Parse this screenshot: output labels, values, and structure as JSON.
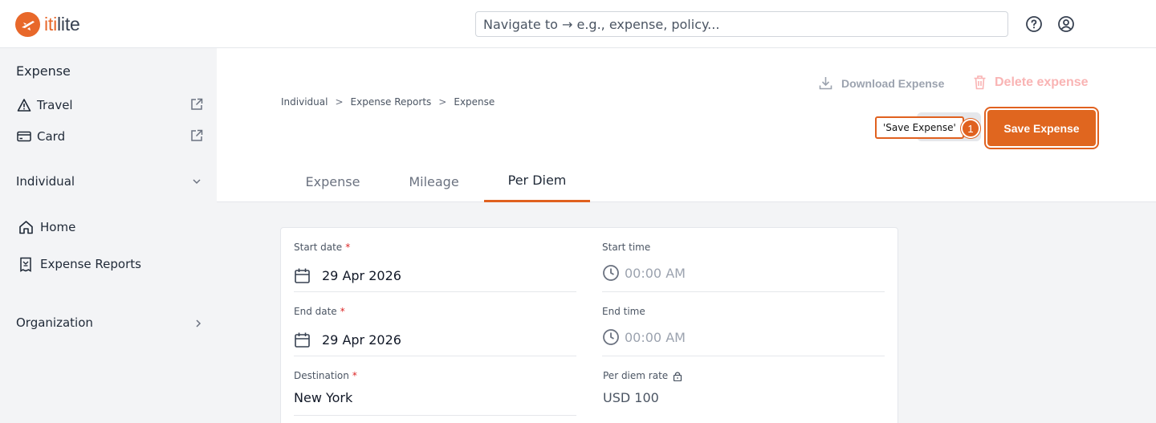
{
  "brand": {
    "prefix": "iti",
    "suffix": "lite",
    "accent_color": "#e8682a"
  },
  "search": {
    "placeholder": "Navigate to → e.g., expense, policy..."
  },
  "header_icons": [
    "help-icon",
    "user-account-icon"
  ],
  "sidebar": {
    "section_expense": "Expense",
    "travel": "Travel",
    "card": "Card",
    "section_individual": "Individual",
    "home": "Home",
    "expense_reports": "Expense Reports",
    "section_organization": "Organization"
  },
  "breadcrumb": [
    "Individual",
    "Expense Reports",
    "Expense"
  ],
  "breadcrumb_sep": ">",
  "actions": {
    "download": "Download Expense",
    "delete": "Delete expense",
    "save": "Save Expense",
    "tooltip": "'Save Expense'",
    "badge": "1"
  },
  "tabs": [
    {
      "label": "Expense",
      "active": false
    },
    {
      "label": "Mileage",
      "active": false
    },
    {
      "label": "Per Diem",
      "active": true
    }
  ],
  "form": {
    "start_date_label": "Start date",
    "start_date": "29 Apr 2026",
    "start_time_label": "Start time",
    "start_time": "00:00 AM",
    "end_date_label": "End date",
    "end_date": "29 Apr 2026",
    "end_time_label": "End time",
    "end_time": "00:00 AM",
    "destination_label": "Destination",
    "destination": "New York",
    "rate_label": "Per diem rate",
    "rate": "USD 100",
    "required_mark": "*"
  }
}
